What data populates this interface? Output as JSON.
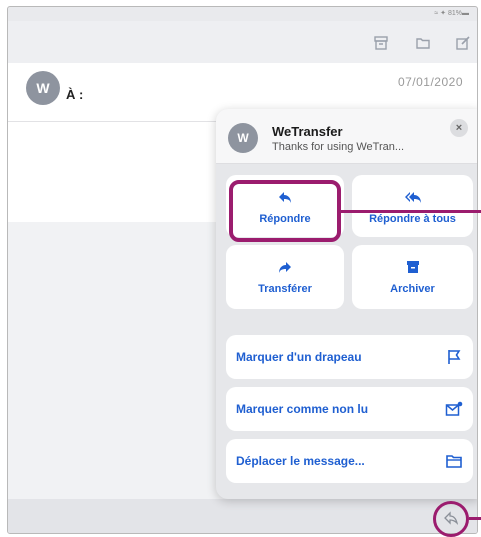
{
  "status_bar": {
    "text": "≈ ✦ 81%▬"
  },
  "mail": {
    "avatar_initial": "W",
    "to_label": "À :",
    "date": "07/01/2020"
  },
  "sheet": {
    "avatar_initial": "W",
    "sender": "WeTransfer",
    "subject": "Thanks for using WeTran...",
    "close_symbol": "×",
    "tiles": {
      "reply": "Répondre",
      "reply_all": "Répondre à tous",
      "forward": "Transférer",
      "archive": "Archiver"
    },
    "rows": {
      "flag": "Marquer d'un drapeau",
      "mark_unread": "Marquer comme non lu",
      "move": "Déplacer le message..."
    }
  },
  "icons": {
    "toolbar": [
      "archive-box-icon",
      "folder-icon",
      "compose-icon"
    ],
    "tiles": [
      "reply-arrow-icon",
      "reply-all-arrow-icon",
      "forward-arrow-icon",
      "archive-icon"
    ],
    "rows": [
      "flag-icon",
      "envelope-unread-icon",
      "folder-icon"
    ],
    "bottom": "reply-icon"
  },
  "colors": {
    "accent": "#1f5fd1",
    "highlight": "#9b1c6e",
    "avatar": "#8e949f"
  }
}
